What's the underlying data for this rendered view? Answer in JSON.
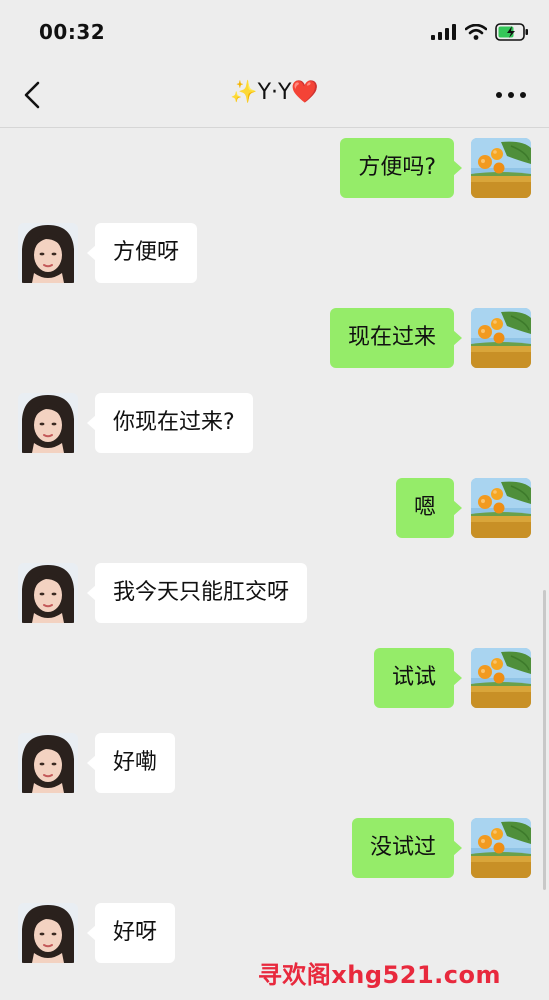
{
  "status": {
    "time": "00:32"
  },
  "header": {
    "title": "✨Y·Y❤️",
    "back_icon": "chevron-left-icon",
    "more_icon": "more-dots-icon"
  },
  "messages": [
    {
      "side": "sent",
      "text": "方便吗?"
    },
    {
      "side": "recv",
      "text": "方便呀"
    },
    {
      "side": "sent",
      "text": "现在过来"
    },
    {
      "side": "recv",
      "text": "你现在过来?"
    },
    {
      "side": "sent",
      "text": "嗯"
    },
    {
      "side": "recv",
      "text": "我今天只能肛交呀"
    },
    {
      "side": "sent",
      "text": "试试"
    },
    {
      "side": "recv",
      "text": "好嘞"
    },
    {
      "side": "sent",
      "text": "没试过"
    },
    {
      "side": "recv",
      "text": "好呀"
    }
  ],
  "watermark": "寻欢阁xhg521.com",
  "colors": {
    "sent_bubble": "#95ec69",
    "recv_bubble": "#ffffff",
    "background": "#ededed",
    "watermark": "#e8293d"
  }
}
